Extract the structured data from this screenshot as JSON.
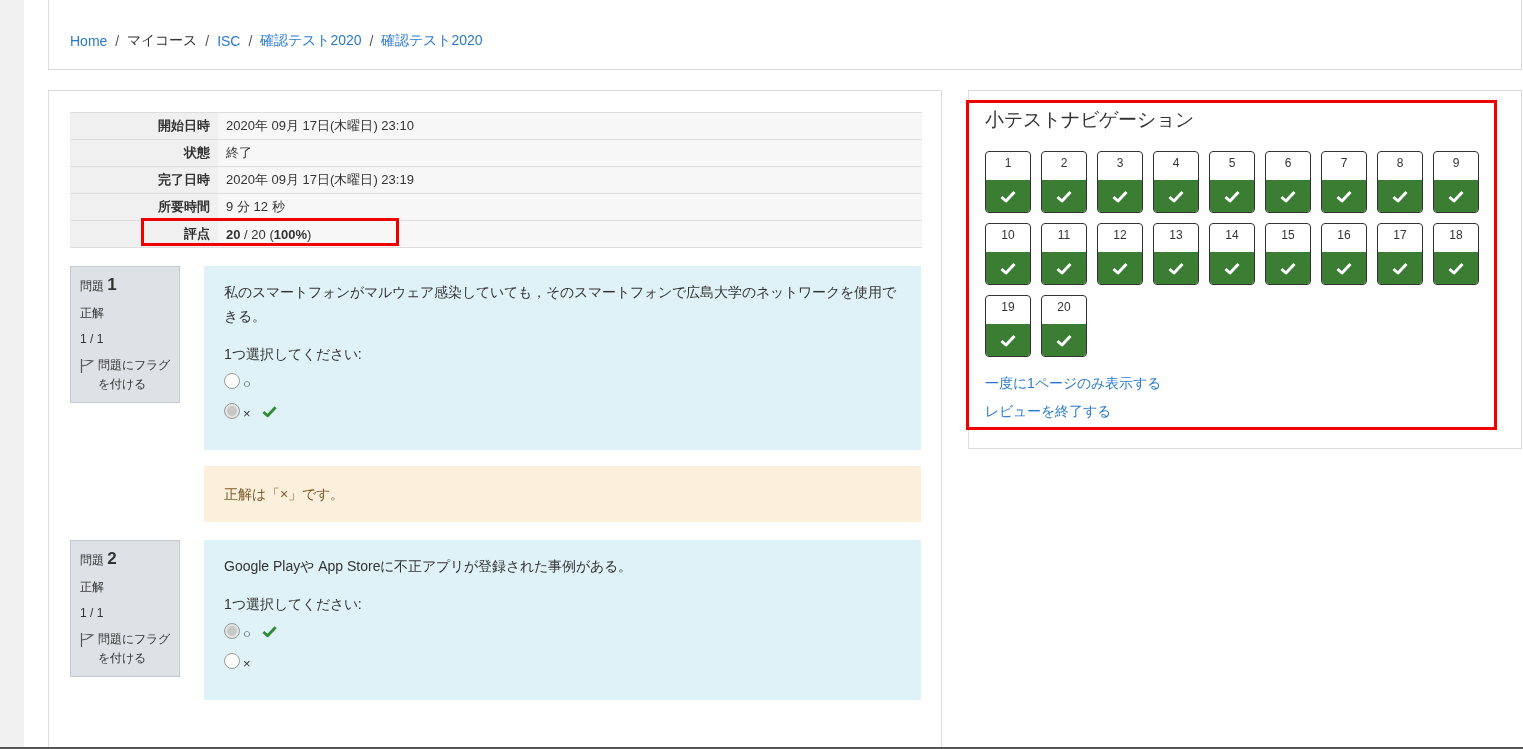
{
  "breadcrumb": [
    {
      "label": "Home",
      "link": true
    },
    {
      "separator": "/",
      "label": "マイコース",
      "link": false
    },
    {
      "separator": "/",
      "label": "ISC",
      "link": true
    },
    {
      "separator": "/",
      "label": "確認テスト2020",
      "link": true
    },
    {
      "separator": "/",
      "label": "確認テスト2020",
      "link": true
    }
  ],
  "summary": [
    {
      "label": "開始日時",
      "value": "2020年 09月 17日(木曜日) 23:10",
      "highlighted": false
    },
    {
      "label": "状態",
      "value": "終了",
      "highlighted": false
    },
    {
      "label": "完了日時",
      "value": "2020年 09月 17日(木曜日) 23:19",
      "highlighted": false
    },
    {
      "label": "所要時間",
      "value": "9 分 12 秒",
      "highlighted": false
    },
    {
      "label": "評点",
      "value": "**20** / 20 (**100%**)",
      "highlighted": true
    }
  ],
  "questions": [
    {
      "prefix": "問題",
      "number": "1",
      "state": "正解",
      "mark": "1 / 1",
      "flag": "問題にフラグを付ける",
      "text": "私のスマートフォンがマルウェア感染していても，そのスマートフォンで広島大学のネットワークを使用できる。",
      "prompt": "1つ選択してください:",
      "options": [
        {
          "label": "○",
          "selected": false,
          "correct": false
        },
        {
          "label": "×",
          "selected": true,
          "correct": true
        }
      ],
      "feedback": "正解は「×」です。"
    },
    {
      "prefix": "問題",
      "number": "2",
      "state": "正解",
      "mark": "1 / 1",
      "flag": "問題にフラグを付ける",
      "text": "Google Playや App Storeに不正アプリが登録された事例がある。",
      "prompt": "1つ選択してください:",
      "options": [
        {
          "label": "○",
          "selected": true,
          "correct": true
        },
        {
          "label": "×",
          "selected": false,
          "correct": false
        }
      ]
    }
  ],
  "navigation": {
    "title": "小テストナビゲーション",
    "highlighted": true,
    "buttons": [
      {
        "label": "1",
        "correct": true
      },
      {
        "label": "2",
        "correct": true
      },
      {
        "label": "3",
        "correct": true
      },
      {
        "label": "4",
        "correct": true
      },
      {
        "label": "5",
        "correct": true
      },
      {
        "label": "6",
        "correct": true
      },
      {
        "label": "7",
        "correct": true
      },
      {
        "label": "8",
        "correct": true
      },
      {
        "label": "9",
        "correct": true
      },
      {
        "label": "10",
        "correct": true
      },
      {
        "label": "11",
        "correct": true
      },
      {
        "label": "12",
        "correct": true
      },
      {
        "label": "13",
        "correct": true
      },
      {
        "label": "14",
        "correct": true
      },
      {
        "label": "15",
        "correct": true
      },
      {
        "label": "16",
        "correct": true
      },
      {
        "label": "17",
        "correct": true
      },
      {
        "label": "18",
        "correct": true
      },
      {
        "label": "19",
        "correct": true
      },
      {
        "label": "20",
        "correct": true
      }
    ],
    "links": [
      "一度に1ページのみ表示する",
      "レビューを終了する"
    ]
  }
}
